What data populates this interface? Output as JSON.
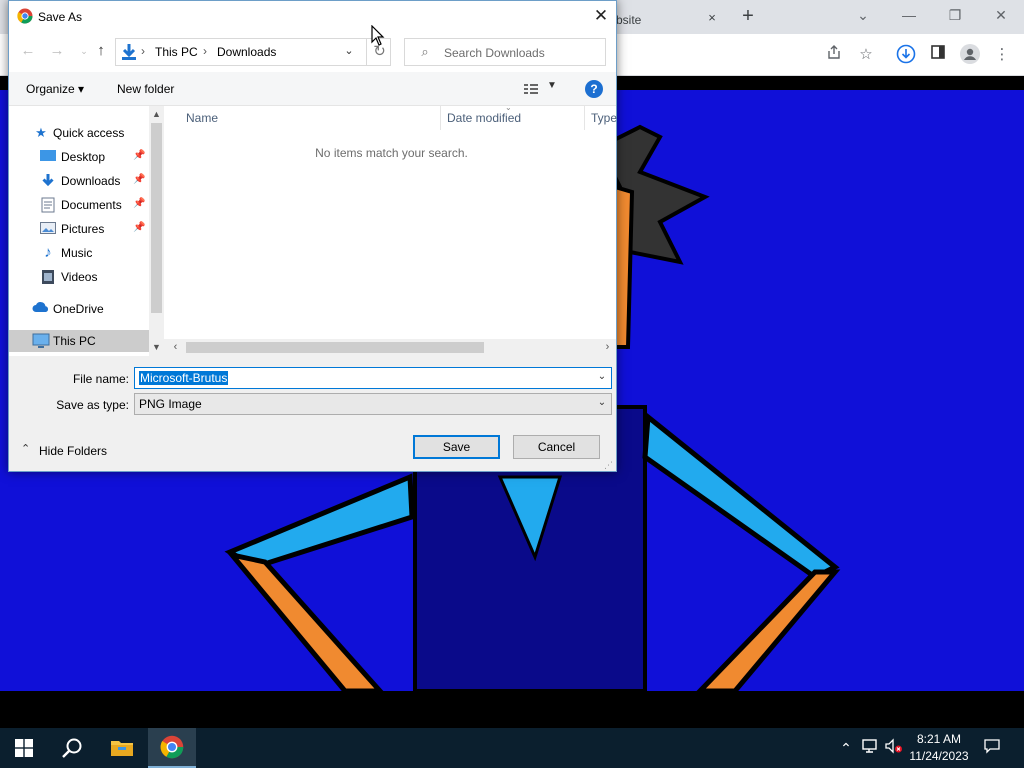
{
  "browser": {
    "tab_title": "bsite",
    "tab_close": "×",
    "new_tab": "+",
    "window_controls": [
      "⌄",
      "—",
      "❐",
      "✕"
    ],
    "toolbar_icons": [
      "share-icon",
      "star-icon",
      "download-icon",
      "sidebar-icon",
      "profile-icon",
      "menu-icon"
    ]
  },
  "dialog": {
    "title": "Save As",
    "close": "✕",
    "breadcrumbs": [
      "This PC",
      "Downloads"
    ],
    "breadcrumb_sep": "›",
    "search_placeholder": "Search Downloads",
    "commands": {
      "organize": "Organize ▾",
      "new_folder": "New folder"
    },
    "help": "?",
    "nav_items": [
      {
        "label": "Quick access",
        "icon": "star-icon",
        "pinned": false
      },
      {
        "label": "Desktop",
        "icon": "desktop-icon",
        "pinned": true
      },
      {
        "label": "Downloads",
        "icon": "download-icon",
        "pinned": true
      },
      {
        "label": "Documents",
        "icon": "documents-icon",
        "pinned": true
      },
      {
        "label": "Pictures",
        "icon": "pictures-icon",
        "pinned": true
      },
      {
        "label": "Music",
        "icon": "music-icon",
        "pinned": false
      },
      {
        "label": "Videos",
        "icon": "videos-icon",
        "pinned": false
      },
      {
        "label": "OneDrive",
        "icon": "cloud-icon",
        "pinned": false
      },
      {
        "label": "This PC",
        "icon": "computer-icon",
        "pinned": false
      }
    ],
    "columns": [
      "Name",
      "Date modified",
      "Type"
    ],
    "empty_message": "No items match your search.",
    "file_name_label": "File name:",
    "file_name": "Microsoft-Brutus",
    "save_type_label": "Save as type:",
    "save_type": "PNG Image",
    "hide_folders": "Hide Folders",
    "save": "Save",
    "cancel": "Cancel"
  },
  "taskbar": {
    "time": "8:21 AM",
    "date": "11/24/2023",
    "apps": [
      "start-icon",
      "search-icon",
      "file-explorer-icon",
      "chrome-icon"
    ]
  },
  "colors": {
    "canvas_blue": "#1010d8",
    "accent": "#0078d7"
  }
}
